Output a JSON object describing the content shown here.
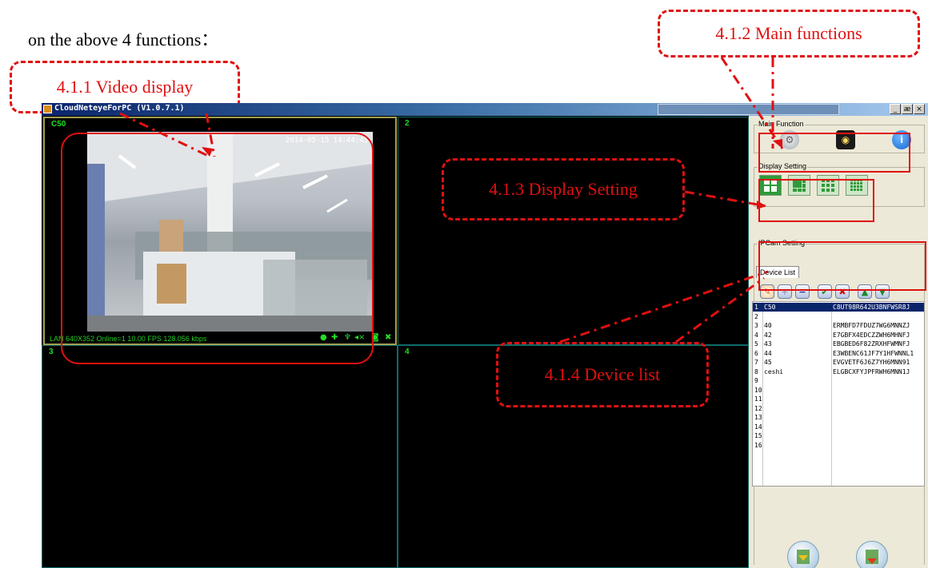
{
  "intro_text": "on the above 4 functions：",
  "callouts": {
    "video_display": "4.1.1 Video display",
    "main_functions": "4.1.2 Main functions",
    "display_setting": "4.1.3 Display Setting",
    "device_list": "4.1.4 Device list"
  },
  "window": {
    "title": "CloudNeteyeForPC (V1.0.7.1)",
    "buttons": [
      "_",
      "æ",
      "×"
    ]
  },
  "video": {
    "cells": [
      {
        "label": "C50",
        "selected": true
      },
      {
        "label": "2"
      },
      {
        "label": "3"
      },
      {
        "label": "4"
      }
    ],
    "timestamp": "2014-05-15 14:44:45",
    "status": "LAN  640X352  Online=1  10.00 FPS  128.056 kbps"
  },
  "panel": {
    "main_function_label": "Main Function",
    "display_setting_label": "Display Setting",
    "ipcam_setting_label": "IPCam Setting",
    "device_list_tab": "Device List",
    "main_icons": [
      "gear-icon",
      "media-player-icon",
      "info-icon"
    ],
    "layout_icons": [
      "grid-2x2-icon",
      "grid-1plus5-icon",
      "grid-3x3-icon",
      "grid-4x4-icon"
    ],
    "toolbar_icons": [
      "edit-icon",
      "add-icon",
      "remove-icon",
      "connect-icon",
      "disconnect-icon",
      "move-up-icon",
      "move-down-icon"
    ],
    "devices": [
      {
        "num": "1",
        "name": "C50",
        "uid": "C8UT98R642U3BNFWSR8J"
      },
      {
        "num": "2",
        "name": "",
        "uid": ""
      },
      {
        "num": "3",
        "name": "40",
        "uid": "ERMBFD7FDUZ7WG6MNNZJ"
      },
      {
        "num": "4",
        "name": "42",
        "uid": "E7GBFX4EDCZZWH6MHNFJ"
      },
      {
        "num": "5",
        "name": "43",
        "uid": "EBGBED6F82ZRXHFWMNFJ"
      },
      {
        "num": "6",
        "name": "44",
        "uid": "E3WBENC61JF7Y1HFWNNL1"
      },
      {
        "num": "7",
        "name": "45",
        "uid": "EVGVETF6J6Z7YH6MNN91"
      },
      {
        "num": "8",
        "name": "ceshi",
        "uid": "ELGBCXFYJPFRWH6MNN1J"
      },
      {
        "num": "9",
        "name": "",
        "uid": ""
      },
      {
        "num": "10",
        "name": "",
        "uid": ""
      },
      {
        "num": "11",
        "name": "",
        "uid": ""
      },
      {
        "num": "12",
        "name": "",
        "uid": ""
      },
      {
        "num": "13",
        "name": "",
        "uid": ""
      },
      {
        "num": "14",
        "name": "",
        "uid": ""
      },
      {
        "num": "15",
        "name": "",
        "uid": ""
      },
      {
        "num": "16",
        "name": "",
        "uid": ""
      }
    ],
    "bottom_icons": [
      "import-icon",
      "export-icon"
    ]
  }
}
